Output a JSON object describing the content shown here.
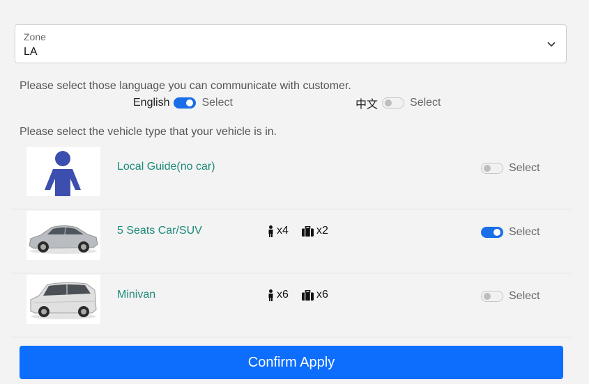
{
  "zone": {
    "label": "Zone",
    "value": "LA"
  },
  "language_prompt": "Please select those language you can communicate with customer.",
  "languages": [
    {
      "name": "English",
      "select_label": "Select",
      "selected": true
    },
    {
      "name": "中文",
      "select_label": "Select",
      "selected": false
    }
  ],
  "vehicle_prompt": "Please select the vehicle type that your vehicle is in.",
  "vehicles": [
    {
      "name": "Local Guide(no car)",
      "image": "person-icon",
      "passengers": "",
      "luggage": "",
      "select_label": "Select",
      "selected": false
    },
    {
      "name": "5 Seats Car/SUV",
      "image": "sedan-car-image",
      "passengers": "x4",
      "luggage": "x2",
      "select_label": "Select",
      "selected": true
    },
    {
      "name": "Minivan",
      "image": "minivan-image",
      "passengers": "x6",
      "luggage": "x6",
      "select_label": "Select",
      "selected": false
    }
  ],
  "colors": {
    "accent": "#0d6efd",
    "toggle_on": "#1a6ee8",
    "vehicle_name": "#1b8a78"
  },
  "confirm_label": "Confirm Apply"
}
